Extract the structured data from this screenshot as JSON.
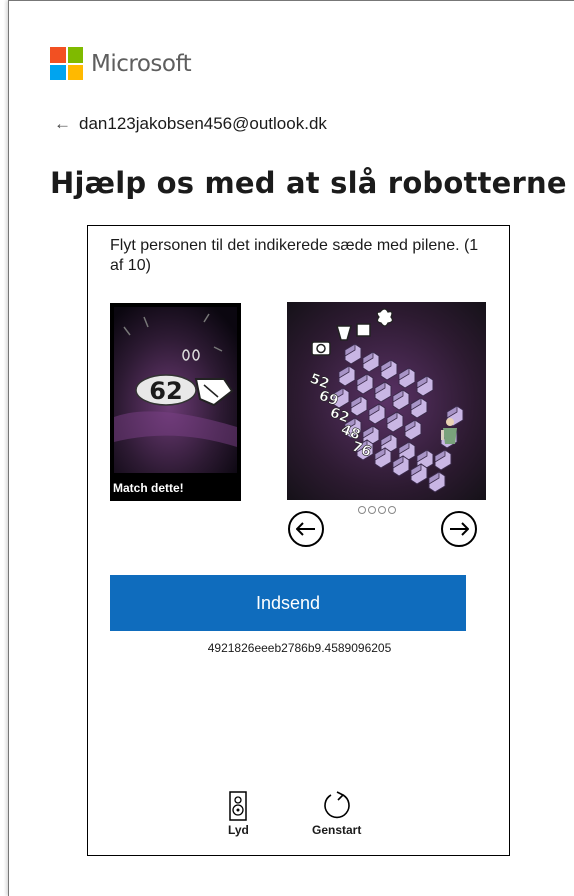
{
  "brand": {
    "name": "Microsoft",
    "colors": [
      "#f25022",
      "#7fba00",
      "#00a4ef",
      "#ffb900"
    ]
  },
  "account": {
    "back_icon": "arrow-left-icon",
    "email": "dan123jakobsen456@outlook.dk"
  },
  "page": {
    "title": "Hjælp os med at slå robotterne"
  },
  "captcha": {
    "instruction": "Flyt personen til det indikerede sæde med pilene. (1 af 10)",
    "target_label": "Match dette!",
    "target_number": "62",
    "seat_numbers": [
      "52",
      "69",
      "62",
      "48",
      "76"
    ],
    "dots_count": 4,
    "prev_icon": "arrow-left-circle-icon",
    "next_icon": "arrow-right-circle-icon",
    "submit_label": "Indsend",
    "submit_color": "#0f6cbd",
    "token": "4921826eeeb2786b9.4589096205",
    "audio_label": "Lyd",
    "audio_icon": "speaker-icon",
    "restart_label": "Genstart",
    "restart_icon": "restart-icon"
  }
}
